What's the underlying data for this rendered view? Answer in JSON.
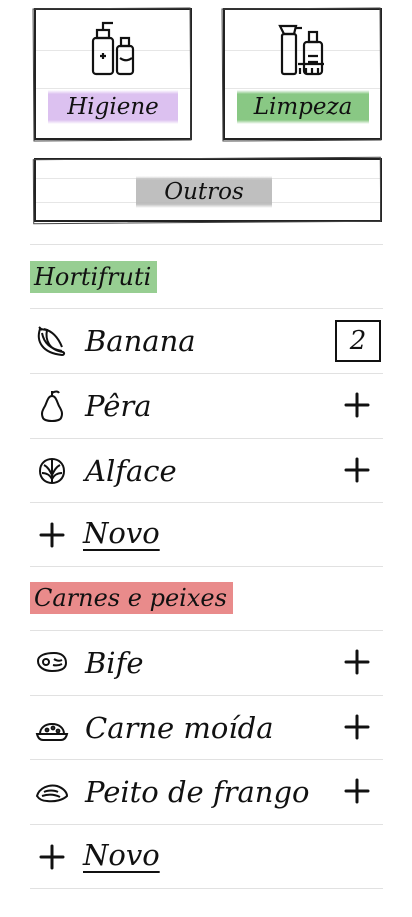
{
  "categories": {
    "higiene": {
      "label": "Higiene",
      "icon": "hygiene-products-icon"
    },
    "limpeza": {
      "label": "Limpeza",
      "icon": "cleaning-products-icon"
    },
    "outros": {
      "label": "Outros"
    }
  },
  "sections": [
    {
      "title": "Hortifruti",
      "highlight": "#74be6e",
      "items": [
        {
          "label": "Banana",
          "icon": "banana-icon",
          "quantity": "2"
        },
        {
          "label": "Pêra",
          "icon": "pear-icon",
          "quantity": null
        },
        {
          "label": "Alface",
          "icon": "lettuce-icon",
          "quantity": null
        }
      ],
      "new_label": "Novo"
    },
    {
      "title": "Carnes e peixes",
      "highlight": "#e26464",
      "items": [
        {
          "label": "Bife",
          "icon": "steak-icon",
          "quantity": null
        },
        {
          "label": "Carne moída",
          "icon": "ground-meat-icon",
          "quantity": null
        },
        {
          "label": "Peito de frango",
          "icon": "chicken-breast-icon",
          "quantity": null
        }
      ],
      "new_label": "Novo"
    }
  ],
  "colors": {
    "higiene_highlight": "#d6b6ed",
    "limpeza_highlight": "#74be6e",
    "outros_highlight": "#b4b4b4"
  }
}
